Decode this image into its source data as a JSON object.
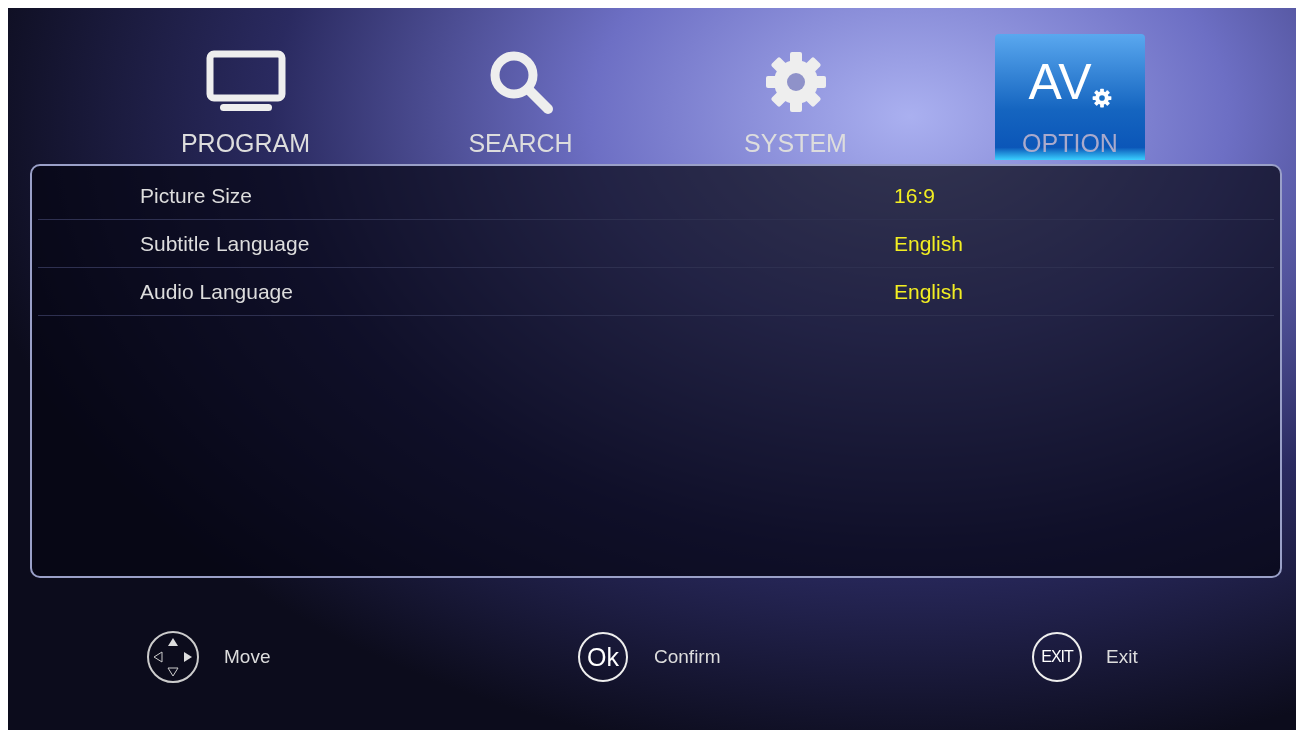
{
  "tabs": [
    {
      "label": "PROGRAM",
      "kind": "tv",
      "selected": false
    },
    {
      "label": "SEARCH",
      "kind": "search",
      "selected": false
    },
    {
      "label": "SYSTEM",
      "kind": "gear",
      "selected": false
    },
    {
      "label": "OPTION",
      "kind": "av",
      "icon_text": "AV",
      "selected": true
    }
  ],
  "settings": [
    {
      "label": "Picture Size",
      "value": "16:9"
    },
    {
      "label": "Subtitle Language",
      "value": "English"
    },
    {
      "label": "Audio Language",
      "value": "English"
    }
  ],
  "key_hints": [
    {
      "kind": "dpad",
      "label": "Move"
    },
    {
      "kind": "ok",
      "key_text": "Ok",
      "label": "Confirm"
    },
    {
      "kind": "exit",
      "key_text": "EXIT",
      "label": "Exit"
    }
  ]
}
